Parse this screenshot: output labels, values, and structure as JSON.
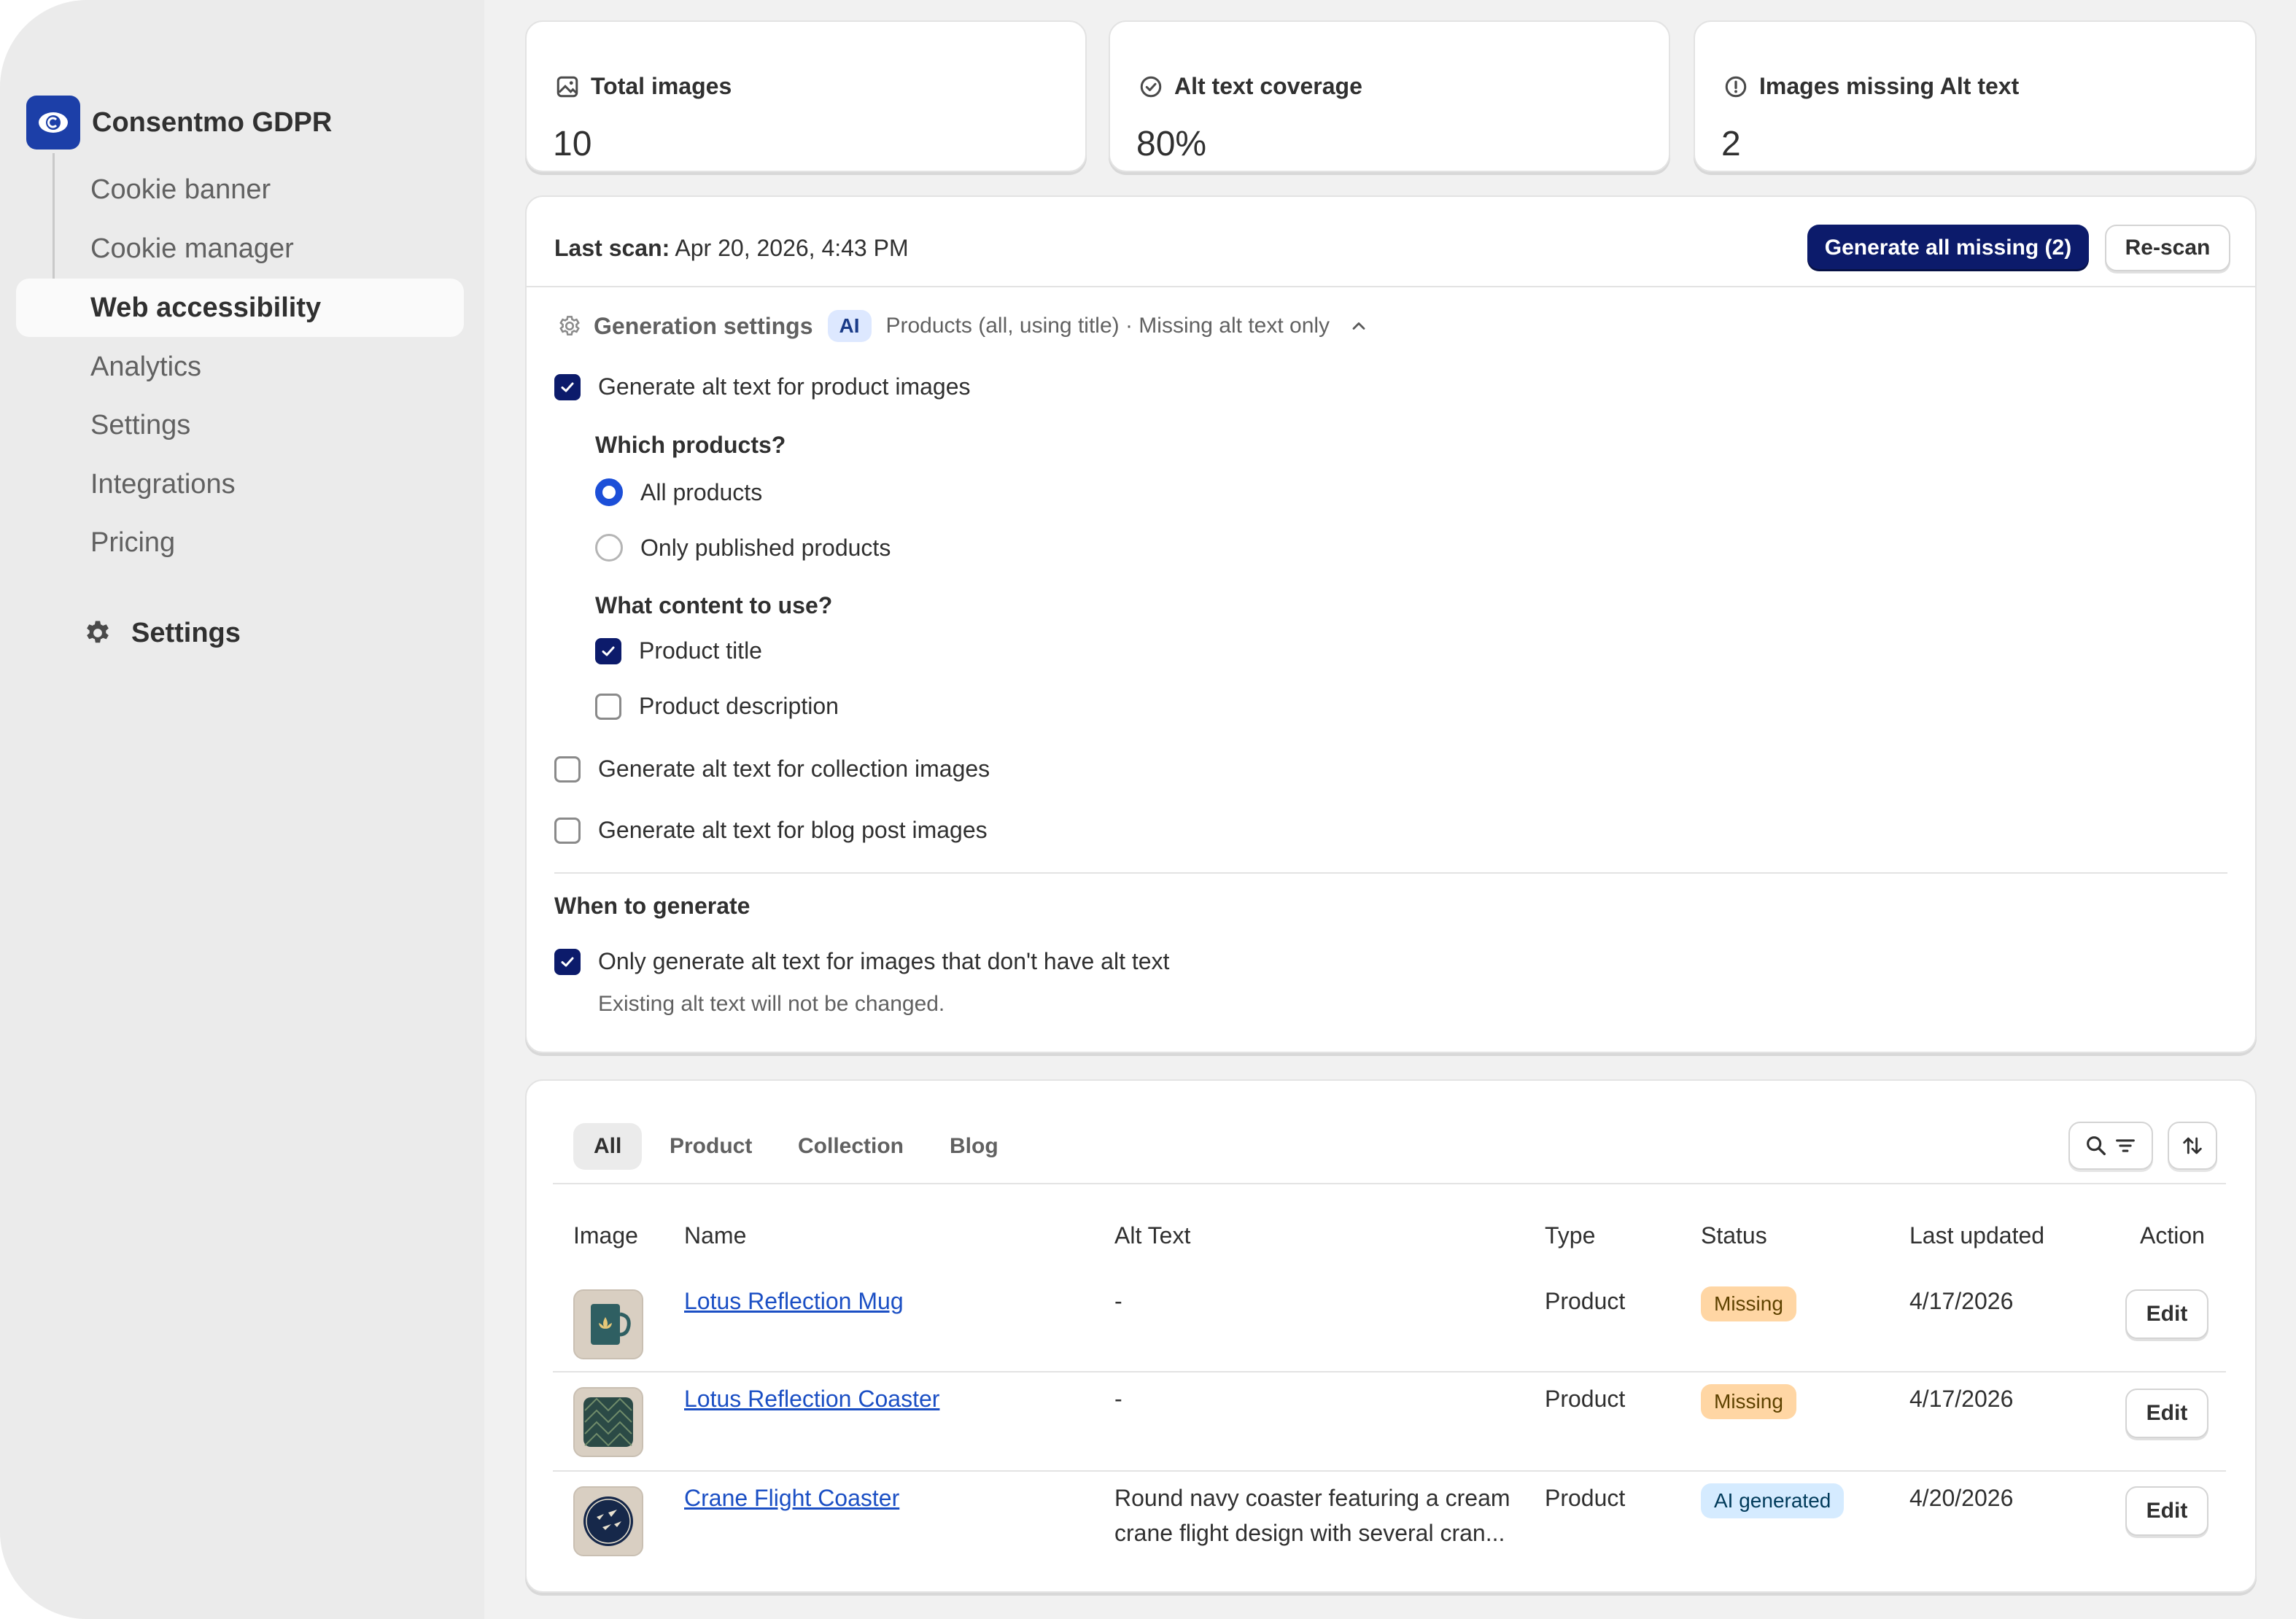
{
  "sidebar": {
    "app_name": "Consentmo GDPR",
    "items": [
      {
        "label": "Cookie banner"
      },
      {
        "label": "Cookie manager"
      },
      {
        "label": "Web accessibility"
      },
      {
        "label": "Analytics"
      },
      {
        "label": "Settings"
      },
      {
        "label": "Integrations"
      },
      {
        "label": "Pricing"
      }
    ],
    "settings_label": "Settings"
  },
  "stats": [
    {
      "title": "Total images",
      "value": "10",
      "icon": "image-icon"
    },
    {
      "title": "Alt text coverage",
      "value": "80%",
      "icon": "check-circle-icon"
    },
    {
      "title": "Images missing Alt text",
      "value": "2",
      "icon": "alert-circle-icon"
    }
  ],
  "scan": {
    "label": "Last scan:",
    "value": "Apr 20, 2026, 4:43 PM",
    "generate_button": "Generate all missing (2)",
    "rescan_button": "Re-scan"
  },
  "generation": {
    "title": "Generation settings",
    "ai_badge": "AI",
    "summary": "Products (all, using title) · Missing alt text only",
    "product_images": "Generate alt text for product images",
    "which_products": "Which products?",
    "all_products": "All products",
    "published_products": "Only published products",
    "what_content": "What content to use?",
    "product_title": "Product title",
    "product_description": "Product description",
    "collection_images": "Generate alt text for collection images",
    "blog_images": "Generate alt text for blog post images",
    "when_heading": "When to generate",
    "only_missing": "Only generate alt text for images that don't have alt text",
    "only_missing_help": "Existing alt text will not be changed."
  },
  "table": {
    "tabs": [
      "All",
      "Product",
      "Collection",
      "Blog"
    ],
    "columns": [
      "Image",
      "Name",
      "Alt Text",
      "Type",
      "Status",
      "Last updated",
      "Action"
    ],
    "rows": [
      {
        "name": "Lotus Reflection Mug",
        "alt": "-",
        "type": "Product",
        "status": "Missing",
        "updated": "4/17/2026",
        "action": "Edit"
      },
      {
        "name": "Lotus Reflection Coaster",
        "alt": "-",
        "type": "Product",
        "status": "Missing",
        "updated": "4/17/2026",
        "action": "Edit"
      },
      {
        "name": "Crane Flight Coaster",
        "alt_line1": "Round navy coaster featuring a cream",
        "alt_line2": "crane flight design with several cran...",
        "type": "Product",
        "status": "AI generated",
        "updated": "4/20/2026",
        "action": "Edit"
      }
    ]
  },
  "colors": {
    "primary": "#0c1b6b",
    "link": "#1b4fc4",
    "missing_badge": "#ffd6a4",
    "ai_badge": "#d5ebff"
  }
}
